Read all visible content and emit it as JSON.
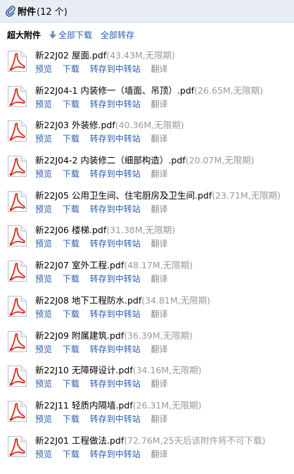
{
  "header": {
    "title": "附件",
    "count": "(12 个)"
  },
  "toolbar": {
    "label": "超大附件",
    "download_all": "全部下载",
    "transfer_all": "全部转存"
  },
  "actions": {
    "preview": "预览",
    "download": "下载",
    "transfer": "转存到中转站",
    "translate": "翻译"
  },
  "files": [
    {
      "name": "新22J02 屋面.pdf",
      "meta": "(43.43M,无限期)"
    },
    {
      "name": "新22J04-1 内装修一（墙面、吊顶）.pdf",
      "meta": "(26.65M,无限期)"
    },
    {
      "name": "新22J03 外装修.pdf",
      "meta": "(40.36M,无限期)"
    },
    {
      "name": "新22J04-2 内装修二（细部构造）.pdf",
      "meta": "(20.07M,无限期)"
    },
    {
      "name": "新22J05 公用卫生间、住宅厨房及卫生间.pdf",
      "meta": "(23.71M,无限期)"
    },
    {
      "name": "新22J06 楼梯.pdf",
      "meta": "(31.38M,无限期)"
    },
    {
      "name": "新22J07 室外工程.pdf",
      "meta": "(48.17M,无限期)"
    },
    {
      "name": "新22J08 地下工程防水.pdf",
      "meta": "(34.81M,无限期)"
    },
    {
      "name": "新22J09 附属建筑.pdf",
      "meta": "(36.39M,无限期)"
    },
    {
      "name": "新22J10 无障碍设计.pdf",
      "meta": "(34.16M,无限期)"
    },
    {
      "name": "新22J11 轻质内隔墙.pdf",
      "meta": "(26.31M,无限期)"
    },
    {
      "name": "新22J01 工程做法.pdf",
      "meta": "(72.76M,25天后该附件将不可下载)"
    }
  ],
  "colors": {
    "link": "#2a5cae",
    "meta": "#999999",
    "header_bg": "#e8edf5"
  }
}
